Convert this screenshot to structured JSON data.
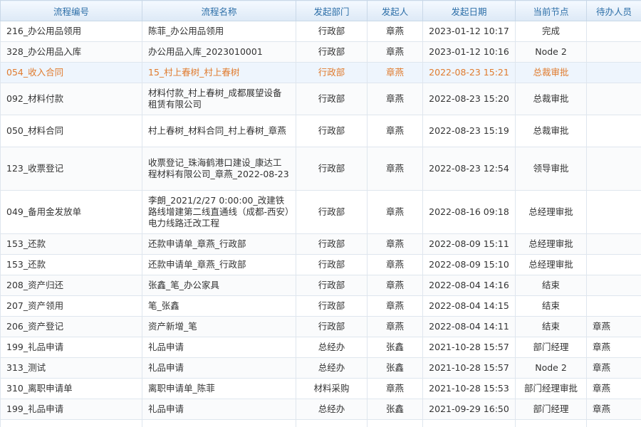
{
  "columns": [
    "流程编号",
    "流程名称",
    "发起部门",
    "发起人",
    "发起日期",
    "当前节点",
    "待办人员"
  ],
  "rows": [
    {
      "id": "216_办公用品领用",
      "name": "陈菲_办公用品领用",
      "dept": "行政部",
      "user": "章燕",
      "date": "2023-01-12 10:17",
      "node": "完成",
      "todo": "",
      "lines": 1
    },
    {
      "id": "328_办公用品入库",
      "name": "办公用品入库_2023010001",
      "dept": "行政部",
      "user": "章燕",
      "date": "2023-01-12 10:16",
      "node": "Node 2",
      "todo": "",
      "lines": 1
    },
    {
      "id": "054_收入合同",
      "name": "15_村上春树_村上春树",
      "dept": "行政部",
      "user": "章燕",
      "date": "2022-08-23 15:21",
      "node": "总裁审批",
      "todo": "",
      "lines": 1,
      "selected": true
    },
    {
      "id": "092_材料付款",
      "name": "材料付款_村上春树_成都展望设备租赁有限公司",
      "dept": "行政部",
      "user": "章燕",
      "date": "2022-08-23 15:20",
      "node": "总裁审批",
      "todo": "",
      "lines": 2
    },
    {
      "id": "050_材料合同",
      "name": "村上春树_材料合同_村上春树_章燕",
      "dept": "行政部",
      "user": "章燕",
      "date": "2022-08-23 15:19",
      "node": "总裁审批",
      "todo": "",
      "lines": 2
    },
    {
      "id": "123_收票登记",
      "name": "收票登记_珠海鹤港口建设_康达工程材料有限公司_章燕_2022-08-23",
      "dept": "行政部",
      "user": "章燕",
      "date": "2022-08-23 12:54",
      "node": "领导审批",
      "todo": "",
      "lines": 3
    },
    {
      "id": "049_备用金发放单",
      "name": "李朗_2021/2/27 0:00:00_改建铁路线增建第二线直通线（成都-西安）电力线路迁改工程",
      "dept": "行政部",
      "user": "章燕",
      "date": "2022-08-16 09:18",
      "node": "总经理审批",
      "todo": "",
      "lines": 3
    },
    {
      "id": "153_还款",
      "name": "还款申请单_章燕_行政部",
      "dept": "行政部",
      "user": "章燕",
      "date": "2022-08-09 15:11",
      "node": "总经理审批",
      "todo": "",
      "lines": 1
    },
    {
      "id": "153_还款",
      "name": "还款申请单_章燕_行政部",
      "dept": "行政部",
      "user": "章燕",
      "date": "2022-08-09 15:10",
      "node": "总经理审批",
      "todo": "",
      "lines": 1
    },
    {
      "id": "208_资产归还",
      "name": "张鑫_笔_办公家具",
      "dept": "行政部",
      "user": "章燕",
      "date": "2022-08-04 14:16",
      "node": "结束",
      "todo": "",
      "lines": 1
    },
    {
      "id": "207_资产领用",
      "name": "笔_张鑫",
      "dept": "行政部",
      "user": "章燕",
      "date": "2022-08-04 14:15",
      "node": "结束",
      "todo": "",
      "lines": 1
    },
    {
      "id": "206_资产登记",
      "name": "资产新增_笔",
      "dept": "行政部",
      "user": "章燕",
      "date": "2022-08-04 14:11",
      "node": "结束",
      "todo": "章燕",
      "lines": 1
    },
    {
      "id": "199_礼品申请",
      "name": "礼品申请",
      "dept": "总经办",
      "user": "张鑫",
      "date": "2021-10-28 15:57",
      "node": "部门经理",
      "todo": "章燕",
      "lines": 1
    },
    {
      "id": "313_测试",
      "name": "礼品申请",
      "dept": "总经办",
      "user": "张鑫",
      "date": "2021-10-28 15:57",
      "node": "Node 2",
      "todo": "章燕",
      "lines": 1
    },
    {
      "id": "310_离职申请单",
      "name": "离职申请单_陈菲",
      "dept": "材料采购",
      "user": "章燕",
      "date": "2021-10-28 15:53",
      "node": "部门经理审批",
      "todo": "章燕",
      "lines": 1
    },
    {
      "id": "199_礼品申请",
      "name": "礼品申请",
      "dept": "总经办",
      "user": "张鑫",
      "date": "2021-09-29 16:50",
      "node": "部门经理",
      "todo": "章燕",
      "lines": 1
    },
    {
      "id": "",
      "name": "",
      "dept": "",
      "user": "",
      "date": "",
      "node": "",
      "todo": "",
      "lines": 1
    }
  ]
}
